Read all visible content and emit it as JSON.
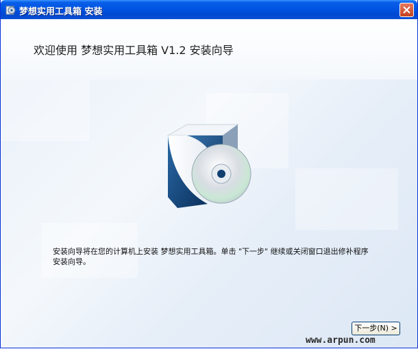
{
  "window": {
    "title": "梦想实用工具箱 安装",
    "close_icon": "close-icon"
  },
  "header": {
    "title": "欢迎使用 梦想实用工具箱 V1.2 安装向导"
  },
  "body": {
    "description_line1": "安装向导将在您的计算机上安装 梦想实用工具箱。单击 \"下一步\" 继续或关闭窗口退出修补程序",
    "description_line2": "安装向导。",
    "image": "software-box-cd-icon"
  },
  "buttons": {
    "next_label": "下一步(N) >"
  },
  "watermark": "www.arpun.com",
  "colors": {
    "titlebar": "#0054e3",
    "close": "#d5502f"
  }
}
